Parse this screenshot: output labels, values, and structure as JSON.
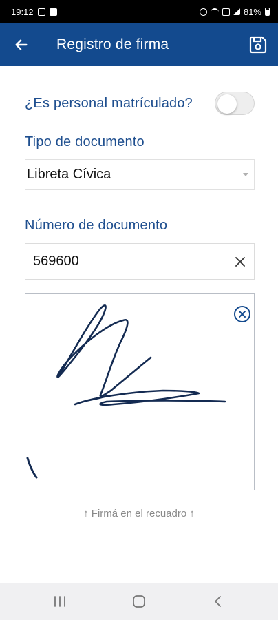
{
  "status_bar": {
    "time": "19:12",
    "battery": "81%"
  },
  "app_bar": {
    "title": "Registro de firma",
    "background": "#134a8e"
  },
  "form": {
    "personal_question": "¿Es personal matrículado?",
    "personal_toggle_on": false,
    "doc_type_label": "Tipo de documento",
    "doc_type_value": "Libreta Cívica",
    "doc_number_label": "Número de documento",
    "doc_number_value": "569600"
  },
  "signature": {
    "hint": "↑ Firmá en el recuadro ↑",
    "stroke_color": "#142b52"
  },
  "icons": {
    "back": "arrow-left-icon",
    "save": "floppy-disk-icon",
    "clear_input": "close-icon",
    "clear_signature": "circle-close-icon",
    "nav_recents": "recents-icon",
    "nav_home": "home-icon",
    "nav_back": "chevron-left-icon"
  }
}
